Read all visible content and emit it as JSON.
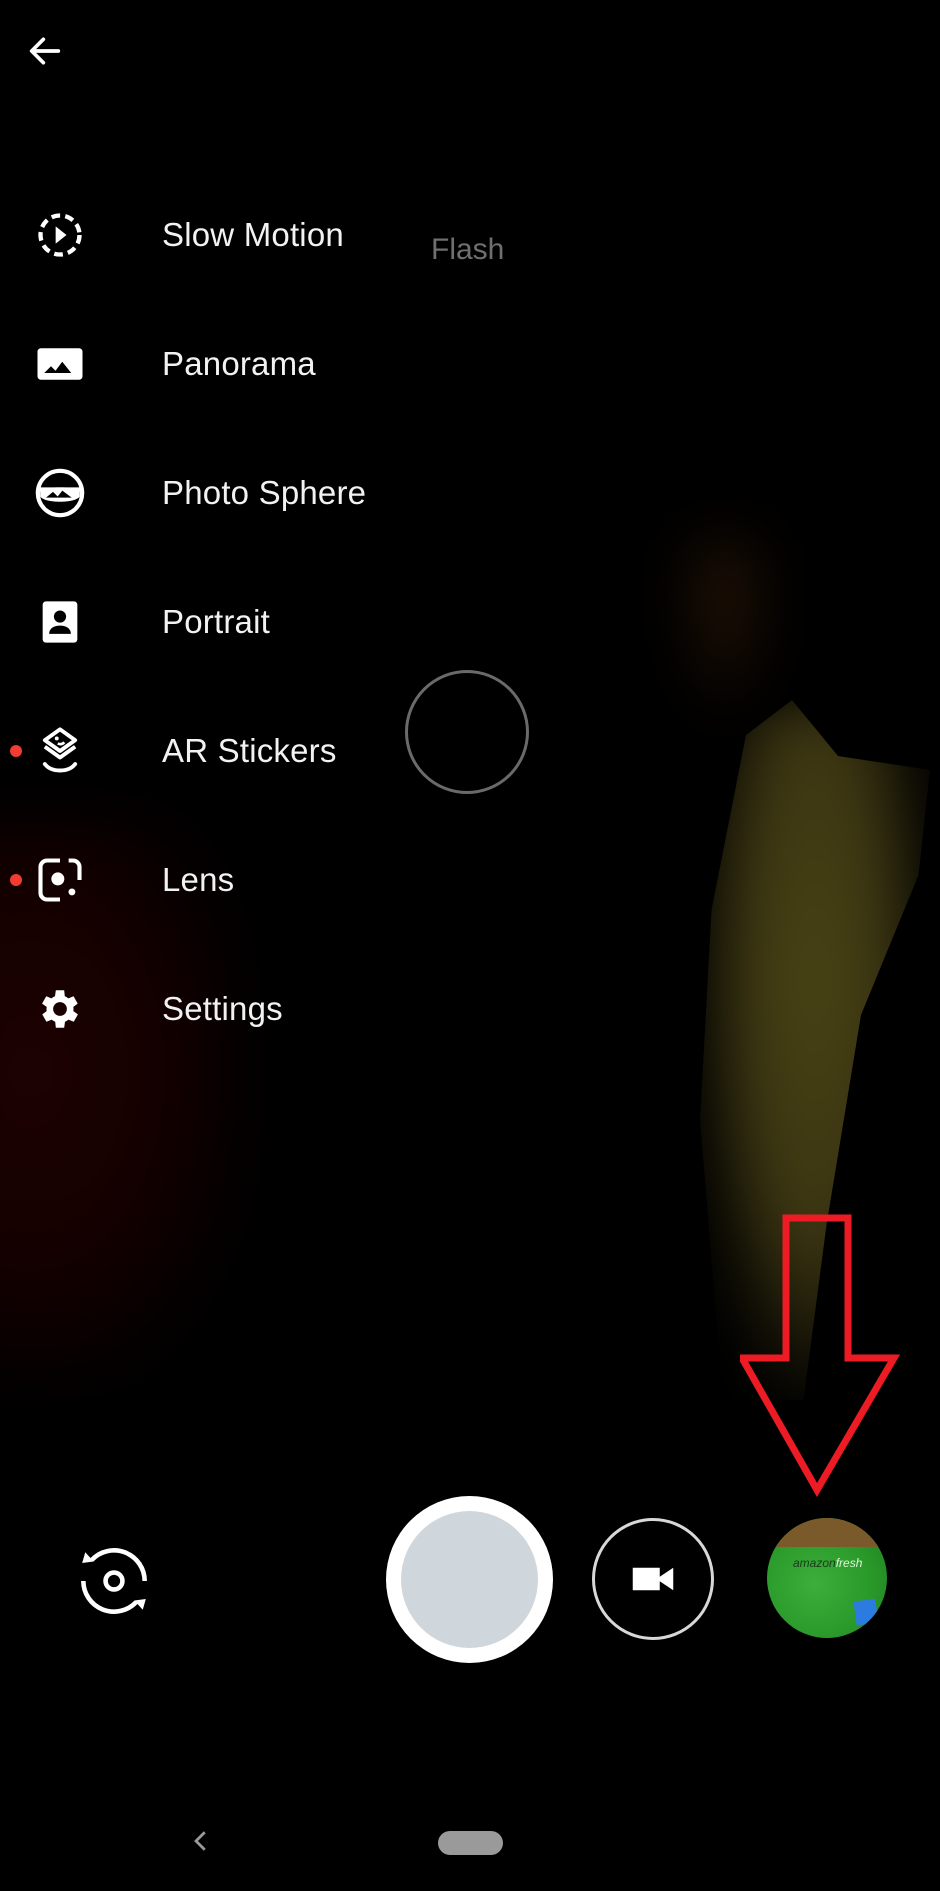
{
  "header": {
    "back_icon": "arrow-left-icon"
  },
  "mode_menu": {
    "items": [
      {
        "label": "Slow Motion",
        "icon": "slow-motion-icon",
        "new_badge": false
      },
      {
        "label": "Panorama",
        "icon": "panorama-icon",
        "new_badge": false
      },
      {
        "label": "Photo Sphere",
        "icon": "photo-sphere-icon",
        "new_badge": false
      },
      {
        "label": "Portrait",
        "icon": "portrait-icon",
        "new_badge": true
      },
      {
        "label": "AR Stickers",
        "icon": "ar-stickers-icon",
        "new_badge": true
      },
      {
        "label": "Lens",
        "icon": "lens-icon",
        "new_badge": true
      },
      {
        "label": "Settings",
        "icon": "gear-icon",
        "new_badge": false
      }
    ]
  },
  "overlay": {
    "flash_label": "Flash"
  },
  "controls": {
    "switch_camera_icon": "switch-camera-icon",
    "shutter_icon": "shutter-button",
    "video_icon": "video-camera-icon",
    "gallery_thumbnail": {
      "icon": "gallery-thumbnail",
      "text_dark": "amazon",
      "text_light": "fresh"
    }
  },
  "annotation": {
    "arrow_color": "#ed1c24",
    "points_to": "gallery-thumbnail"
  },
  "nav_bar": {
    "back_icon": "nav-back-icon",
    "home_icon": "nav-home-pill"
  },
  "colors": {
    "badge_dot": "#f23b31",
    "shutter_fill": "#cfd7dc",
    "flash_text": "#6f6f6f"
  }
}
